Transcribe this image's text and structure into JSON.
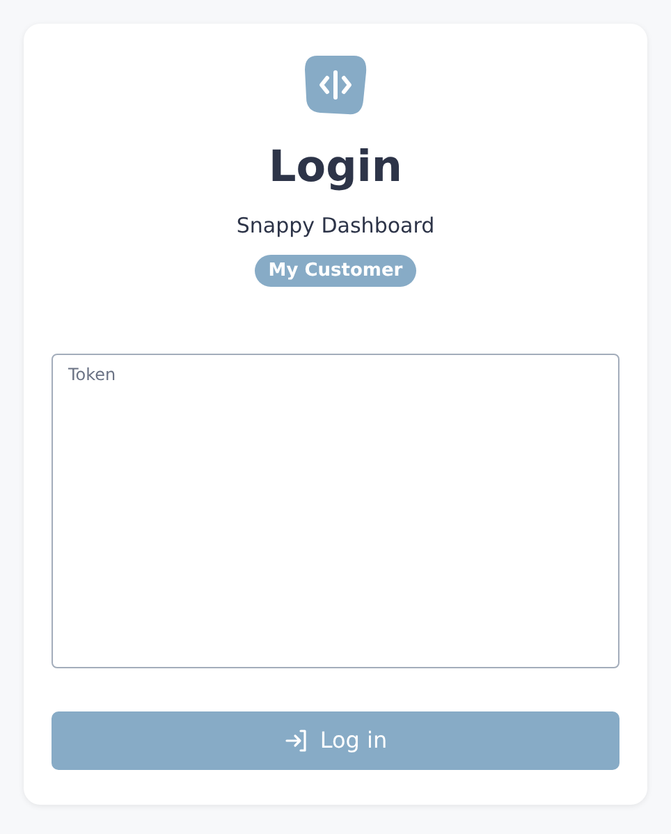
{
  "title": "Login",
  "subtitle": "Snappy Dashboard",
  "badge": "My Customer",
  "token_field": {
    "placeholder": "Token"
  },
  "login_button": {
    "label": "Log in"
  }
}
